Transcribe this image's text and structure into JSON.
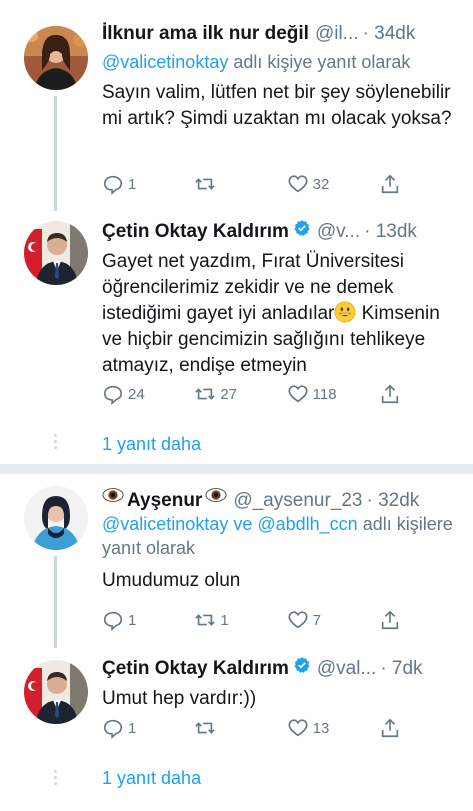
{
  "tweets": [
    {
      "name": "İlknur ama ilk nur değil",
      "handle": "@il...",
      "time": "· 34dk",
      "reply_prefix": "@valicetinoktay",
      "reply_suffix": " adlı kişiye yanıt olarak",
      "text": "Sayın valim, lütfen net bir şey söylenebilir mi artık? Şimdi uzaktan mı olacak yoksa?",
      "reply_count": "1",
      "retweet_count": "",
      "like_count": "32"
    },
    {
      "name": "Çetin Oktay Kaldırım",
      "handle": "@v...",
      "time": "· 13dk",
      "text_before_emoji": "Gayet net yazdım, Fırat Üniversitesi öğrencilerimiz zekidir ve ne demek istediğimi gayet iyi anladılar",
      "text_after_emoji": " Kimsenin ve hiçbir gencimizin sağlığını tehlikeye atmayız, endişe etmeyin",
      "reply_count": "24",
      "retweet_count": "27",
      "like_count": "118"
    },
    {
      "name": "Ayşenur",
      "handle": "@_aysenur_23",
      "time": "· 32dk",
      "reply_mention_1": "@valicetinoktay",
      "reply_middle": " ve ",
      "reply_mention_2": "@abdlh_ccn",
      "reply_suffix": " adlı kişilere yanıt olarak",
      "text": "Umudumuz olun",
      "reply_count": "1",
      "retweet_count": "1",
      "like_count": "7"
    },
    {
      "name": "Çetin Oktay Kaldırım",
      "handle": "@val...",
      "time": "· 7dk",
      "text": "Umut hep vardır:))",
      "reply_count": "1",
      "retweet_count": "",
      "like_count": "13"
    }
  ],
  "more_replies_label": "1 yanıt daha",
  "colors": {
    "link_blue": "#1da1f2",
    "muted_gray": "#657786",
    "separator": "#e6ecf0",
    "verified_blue": "#1da1f2"
  },
  "icons": [
    "reply-icon",
    "retweet-icon",
    "like-icon",
    "share-icon",
    "verified-icon",
    "eye-emoji-icon",
    "grinning-emoji-icon"
  ]
}
